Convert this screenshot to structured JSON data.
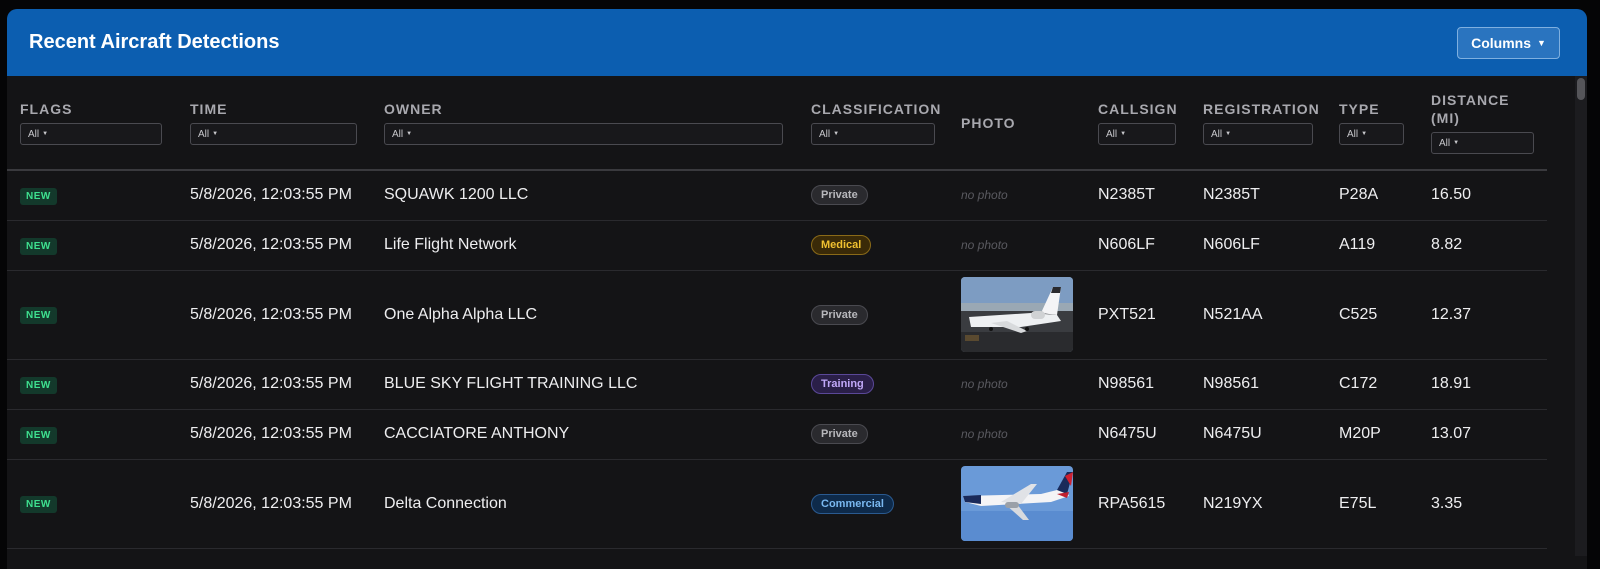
{
  "header": {
    "title": "Recent Aircraft Detections",
    "columns_label": "Columns"
  },
  "columns": [
    {
      "key": "flags",
      "label": "FLAGS",
      "filter": "All"
    },
    {
      "key": "time",
      "label": "TIME",
      "filter": "All"
    },
    {
      "key": "owner",
      "label": "OWNER",
      "filter": "All"
    },
    {
      "key": "classification",
      "label": "CLASSIFICATION",
      "filter": "All"
    },
    {
      "key": "photo",
      "label": "PHOTO"
    },
    {
      "key": "callsign",
      "label": "CALLSIGN",
      "filter": "All"
    },
    {
      "key": "registration",
      "label": "REGISTRATION",
      "filter": "All"
    },
    {
      "key": "type",
      "label": "TYPE",
      "filter": "All"
    },
    {
      "key": "distance",
      "label": "DISTANCE (MI)",
      "filter": "All"
    }
  ],
  "no_photo_text": "no photo",
  "rows": [
    {
      "flag": "NEW",
      "time": "5/8/2026, 12:03:55 PM",
      "owner": "SQUAWK 1200 LLC",
      "classification": "Private",
      "photo": "none",
      "callsign": "N2385T",
      "registration": "N2385T",
      "type": "P28A",
      "distance": "16.50"
    },
    {
      "flag": "NEW",
      "time": "5/8/2026, 12:03:55 PM",
      "owner": "Life Flight Network",
      "classification": "Medical",
      "photo": "none",
      "callsign": "N606LF",
      "registration": "N606LF",
      "type": "A119",
      "distance": "8.82"
    },
    {
      "flag": "NEW",
      "time": "5/8/2026, 12:03:55 PM",
      "owner": "One Alpha Alpha LLC",
      "classification": "Private",
      "photo": "bizjet",
      "callsign": "PXT521",
      "registration": "N521AA",
      "type": "C525",
      "distance": "12.37"
    },
    {
      "flag": "NEW",
      "time": "5/8/2026, 12:03:55 PM",
      "owner": "BLUE SKY FLIGHT TRAINING LLC",
      "classification": "Training",
      "photo": "none",
      "callsign": "N98561",
      "registration": "N98561",
      "type": "C172",
      "distance": "18.91"
    },
    {
      "flag": "NEW",
      "time": "5/8/2026, 12:03:55 PM",
      "owner": "CACCIATORE ANTHONY",
      "classification": "Private",
      "photo": "none",
      "callsign": "N6475U",
      "registration": "N6475U",
      "type": "M20P",
      "distance": "13.07"
    },
    {
      "flag": "NEW",
      "time": "5/8/2026, 12:03:55 PM",
      "owner": "Delta Connection",
      "classification": "Commercial",
      "photo": "airliner",
      "callsign": "RPA5615",
      "registration": "N219YX",
      "type": "E75L",
      "distance": "3.35"
    }
  ],
  "colors": {
    "header_bg": "#0c5eb0",
    "panel_bg": "#141416",
    "new_flag": "#3ee08f",
    "medical": "#f0c030",
    "training": "#c0a8f8",
    "commercial": "#7ab8f0"
  }
}
